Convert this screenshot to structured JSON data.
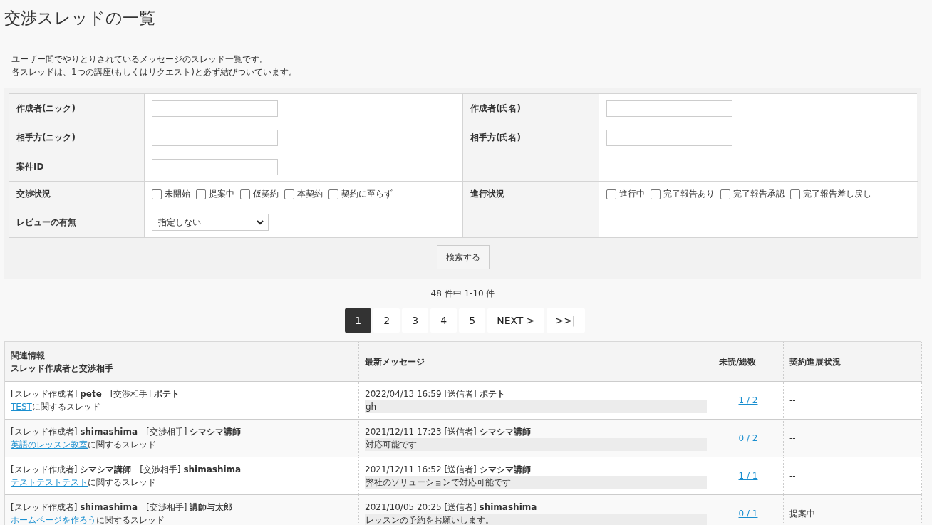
{
  "page_title": "交渉スレッドの一覧",
  "description": [
    "ユーザー間でやりとりされているメッセージのスレッド一覧です。",
    "各スレッドは、1つの講座(もしくはリクエスト)と必ず結びついています。"
  ],
  "search_form": {
    "rows": [
      {
        "cells": [
          {
            "label": "作成者(ニック)",
            "kind": "text"
          },
          {
            "label": "作成者(氏名)",
            "kind": "text"
          }
        ]
      },
      {
        "cells": [
          {
            "label": "相手方(ニック)",
            "kind": "text"
          },
          {
            "label": "相手方(氏名)",
            "kind": "text"
          }
        ]
      },
      {
        "cells": [
          {
            "label": "案件ID",
            "kind": "text"
          },
          {
            "kind": "empty"
          }
        ]
      },
      {
        "cells": [
          {
            "label": "交渉状況",
            "kind": "checks",
            "options": [
              {
                "label": "未開始",
                "checked": false
              },
              {
                "label": "提案中",
                "checked": false
              },
              {
                "label": "仮契約",
                "checked": false
              },
              {
                "label": "本契約",
                "checked": false
              },
              {
                "label": "契約に至らず",
                "checked": false
              }
            ]
          },
          {
            "label": "進行状況",
            "kind": "checks",
            "options": [
              {
                "label": "進行中",
                "checked": false
              },
              {
                "label": "完了報告あり",
                "checked": false
              },
              {
                "label": "完了報告承認",
                "checked": false
              },
              {
                "label": "完了報告差し戻し",
                "checked": false
              }
            ]
          }
        ]
      },
      {
        "cells": [
          {
            "label": "レビューの有無",
            "kind": "select",
            "value": "指定しない"
          },
          {
            "kind": "empty"
          }
        ]
      }
    ],
    "submit": "検索する"
  },
  "result_count": "48 件中 1-10 件",
  "pagination": [
    {
      "label": "1",
      "selected": true
    },
    {
      "label": "2",
      "selected": false
    },
    {
      "label": "3",
      "selected": false
    },
    {
      "label": "4",
      "selected": false
    },
    {
      "label": "5",
      "selected": false
    },
    {
      "label": "NEXT >",
      "selected": false
    },
    {
      "label": ">>|",
      "selected": false
    }
  ],
  "table": {
    "columns": [
      [
        "関連情報",
        "スレッド作成者と交渉相手"
      ],
      [
        "最新メッセージ"
      ],
      [
        "未読/総数"
      ],
      [
        "契約進展状況"
      ]
    ],
    "rows": [
      {
        "parties": "[スレッド作成者] **pete**　[交渉相手] **ポテト**",
        "topic_link": "TEST",
        "topic_suffix": "に関するスレッド",
        "message_meta": "2022/04/13 16:59 [送信者] **ポテト**",
        "message_body": "gh",
        "count": "1 / 2",
        "status": "--"
      },
      {
        "parties": "[スレッド作成者] **shimashima**　[交渉相手] **シマシマ講師**",
        "topic_link": "英語のレッスン教室",
        "topic_suffix": "に関するスレッド",
        "message_meta": "2021/12/11 17:23 [送信者] **シマシマ講師**",
        "message_body": "対応可能です",
        "count": "0 / 2",
        "status": "--"
      },
      {
        "parties": "[スレッド作成者] **シマシマ講師**　[交渉相手] **shimashima**",
        "topic_link": "テストテストテスト",
        "topic_suffix": "に関するスレッド",
        "message_meta": "2021/12/11 16:52 [送信者] **シマシマ講師**",
        "message_body": "弊社のソリューションで対応可能です",
        "count": "1 / 1",
        "status": "--"
      },
      {
        "parties": "[スレッド作成者] **shimashima**　[交渉相手] **講師与太郎**",
        "topic_link": "ホームページを作ろう",
        "topic_suffix": "に関するスレッド",
        "message_meta": "2021/10/05 20:25 [送信者] **shimashima**",
        "message_body": "レッスンの予約をお願いします。",
        "count": "0 / 1",
        "status": "提案中"
      }
    ]
  }
}
